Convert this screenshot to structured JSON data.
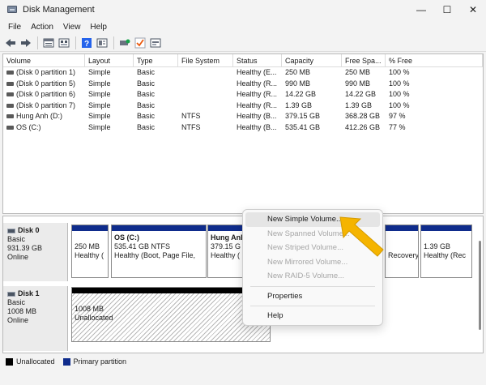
{
  "window": {
    "title": "Disk Management",
    "controls": {
      "minimize": "—",
      "maximize": "☐",
      "close": "✕"
    }
  },
  "menu": [
    "File",
    "Action",
    "View",
    "Help"
  ],
  "toolbar": {
    "icons": [
      "back-icon",
      "forward-icon",
      "list-view-icon",
      "refresh-icon",
      "help-icon",
      "properties-icon",
      "connect-icon",
      "check-icon",
      "settings-icon"
    ]
  },
  "volume_list": {
    "columns": [
      "Volume",
      "Layout",
      "Type",
      "File System",
      "Status",
      "Capacity",
      "Free Spa...",
      "% Free"
    ],
    "rows": [
      [
        "(Disk 0 partition 1)",
        "Simple",
        "Basic",
        "",
        "Healthy (E...",
        "250 MB",
        "250 MB",
        "100 %"
      ],
      [
        "(Disk 0 partition 5)",
        "Simple",
        "Basic",
        "",
        "Healthy (R...",
        "990 MB",
        "990 MB",
        "100 %"
      ],
      [
        "(Disk 0 partition 6)",
        "Simple",
        "Basic",
        "",
        "Healthy (R...",
        "14.22 GB",
        "14.22 GB",
        "100 %"
      ],
      [
        "(Disk 0 partition 7)",
        "Simple",
        "Basic",
        "",
        "Healthy (R...",
        "1.39 GB",
        "1.39 GB",
        "100 %"
      ],
      [
        "Hung Anh (D:)",
        "Simple",
        "Basic",
        "NTFS",
        "Healthy (B...",
        "379.15 GB",
        "368.28 GB",
        "97 %"
      ],
      [
        "OS (C:)",
        "Simple",
        "Basic",
        "NTFS",
        "Healthy (B...",
        "535.41 GB",
        "412.26 GB",
        "77 %"
      ]
    ]
  },
  "disks": [
    {
      "name": "Disk 0",
      "type": "Basic",
      "size": "931.39 GB",
      "status": "Online",
      "partitions": [
        {
          "name": "",
          "size": "250 MB",
          "status": "Healthy ("
        },
        {
          "name": "OS  (C:)",
          "size": "535.41 GB NTFS",
          "status": "Healthy (Boot, Page File,"
        },
        {
          "name": "Hung Anh",
          "size": "379.15 G",
          "status": "Healthy ("
        },
        {
          "name": "",
          "size": "",
          "status": "Recovery"
        },
        {
          "name": "",
          "size": "1.39 GB",
          "status": "Healthy (Rec"
        }
      ]
    },
    {
      "name": "Disk 1",
      "type": "Basic",
      "size": "1008 MB",
      "status": "Online",
      "partitions": [
        {
          "name": "",
          "size": "1008 MB",
          "status": "Unallocated"
        }
      ]
    }
  ],
  "legend": [
    {
      "label": "Unallocated",
      "color": "#000000"
    },
    {
      "label": "Primary partition",
      "color": "#0f2c8c"
    }
  ],
  "context_menu": {
    "items": [
      {
        "label": "New Simple Volume...",
        "enabled": true,
        "highlighted": true
      },
      {
        "label": "New Spanned Volume...",
        "enabled": false
      },
      {
        "label": "New Striped Volume...",
        "enabled": false
      },
      {
        "label": "New Mirrored Volume...",
        "enabled": false
      },
      {
        "label": "New RAID-5 Volume...",
        "enabled": false
      },
      {
        "label": "Properties",
        "enabled": true
      },
      {
        "label": "Help",
        "enabled": true
      }
    ]
  },
  "colors": {
    "primary_partition": "#0f2c8c",
    "unallocated": "#000000",
    "arrow": "#f5b400"
  }
}
